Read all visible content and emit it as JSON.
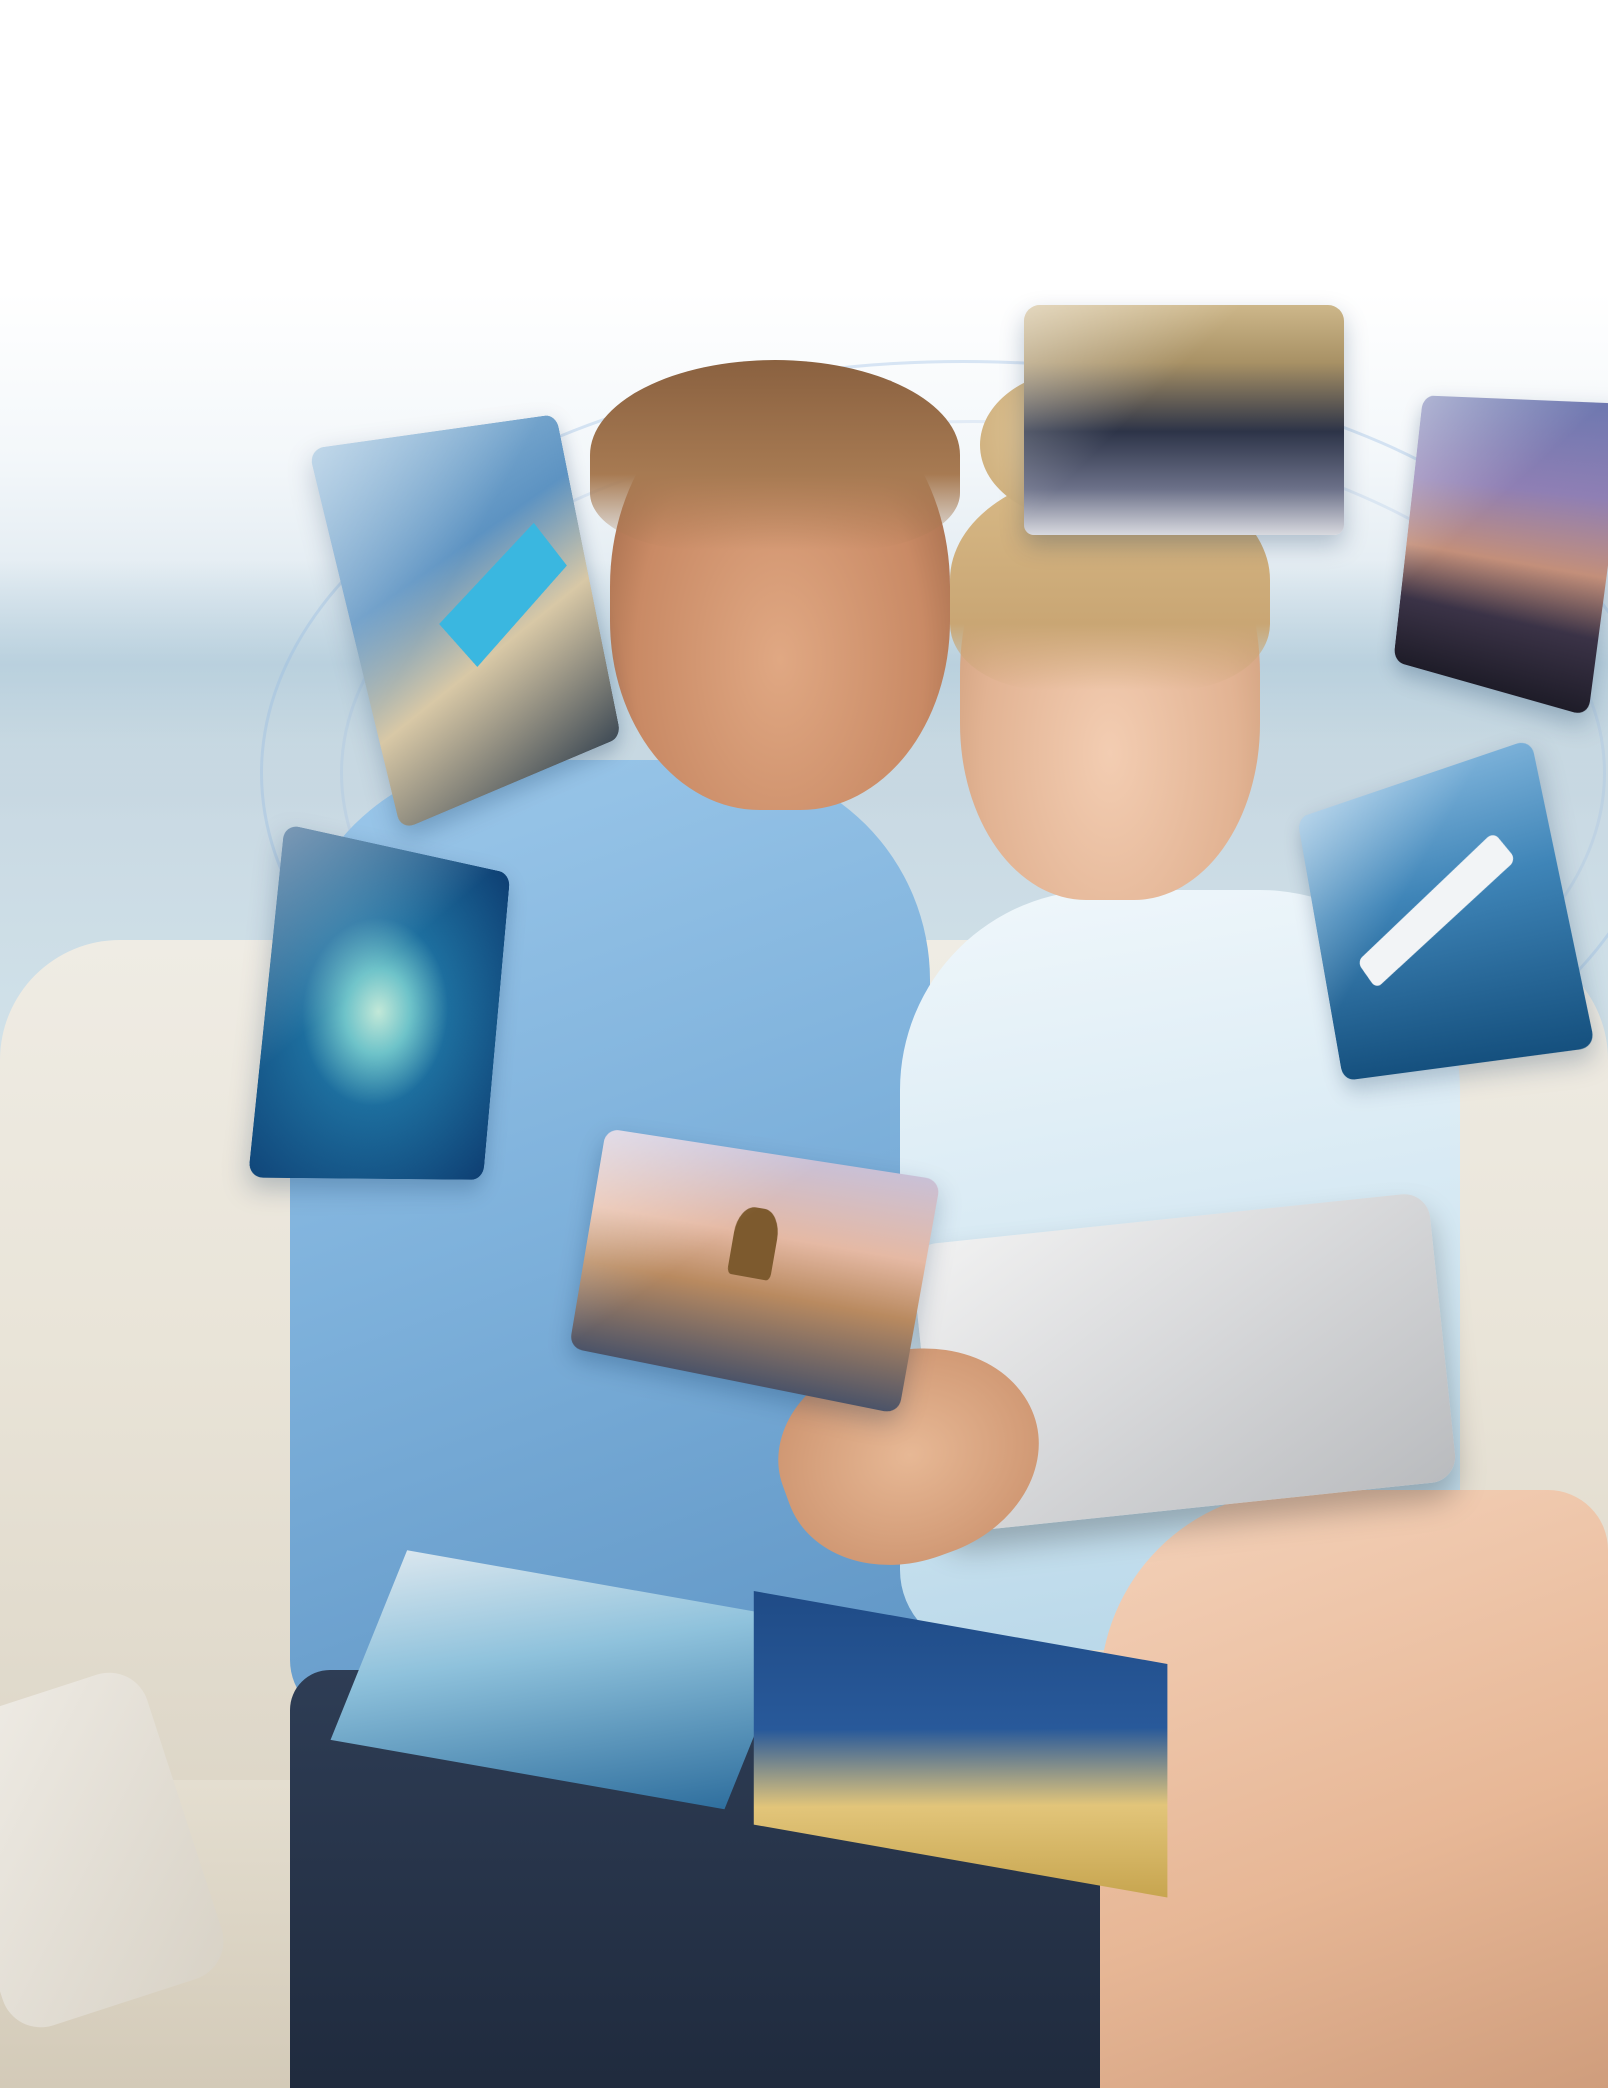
{
  "scene": {
    "description_tag": "",
    "tiles": [
      {
        "id": "pool",
        "icon": "cruise-pool-deck-photo"
      },
      {
        "id": "cabin",
        "icon": "cabin-bedroom-photo"
      },
      {
        "id": "city",
        "icon": "city-skyline-night-photo"
      },
      {
        "id": "island",
        "icon": "tropical-island-photo"
      },
      {
        "id": "ship",
        "icon": "cruise-ship-at-sea-photo"
      },
      {
        "id": "church",
        "icon": "onion-dome-church-photo"
      }
    ],
    "colors": {
      "sky": "#ffffff",
      "sea_haze": "#a8c8d8",
      "sofa": "#e9e4d8",
      "shirt": "#7fb2dc",
      "dress": "#cfe5f1",
      "tablet": "#d6d7d9"
    }
  }
}
